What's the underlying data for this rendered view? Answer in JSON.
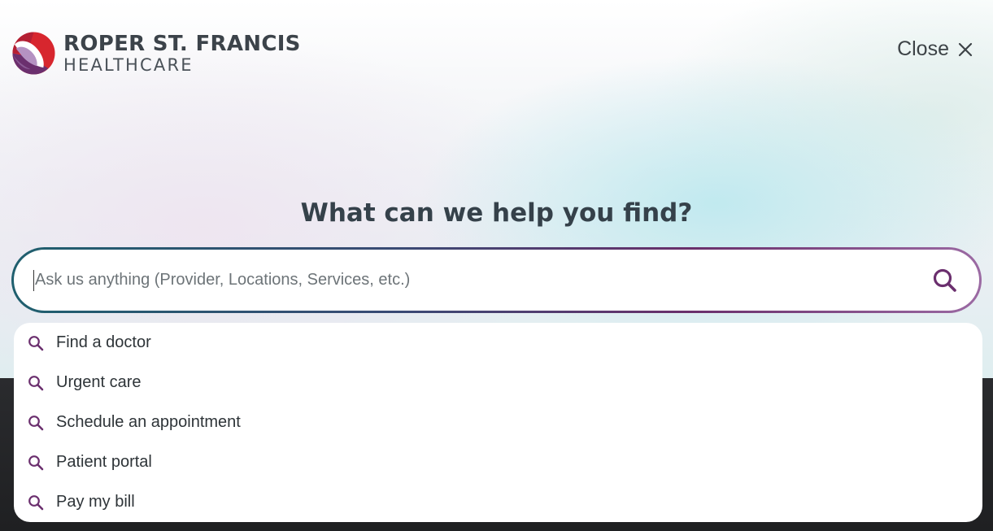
{
  "brand": {
    "name_line1": "ROPER ST. FRANCIS",
    "name_line2": "HEALTHCARE",
    "logo_icon": "rsf-logo-mark",
    "colors": {
      "red": "#d7262e",
      "purple": "#6b2f6e",
      "lavender": "#b592c2"
    }
  },
  "header": {
    "close_label": "Close",
    "close_icon": "close-icon"
  },
  "search": {
    "headline": "What can we help you find?",
    "placeholder": "Ask us anything (Provider, Locations, Services, etc.)",
    "value": "",
    "submit_icon": "search-icon",
    "accent": "#6b2f6e"
  },
  "suggestions": [
    {
      "label": "Find a doctor",
      "icon": "search-icon"
    },
    {
      "label": "Urgent care",
      "icon": "search-icon"
    },
    {
      "label": "Schedule an appointment",
      "icon": "search-icon"
    },
    {
      "label": "Patient portal",
      "icon": "search-icon"
    },
    {
      "label": "Pay my bill",
      "icon": "search-icon"
    }
  ]
}
